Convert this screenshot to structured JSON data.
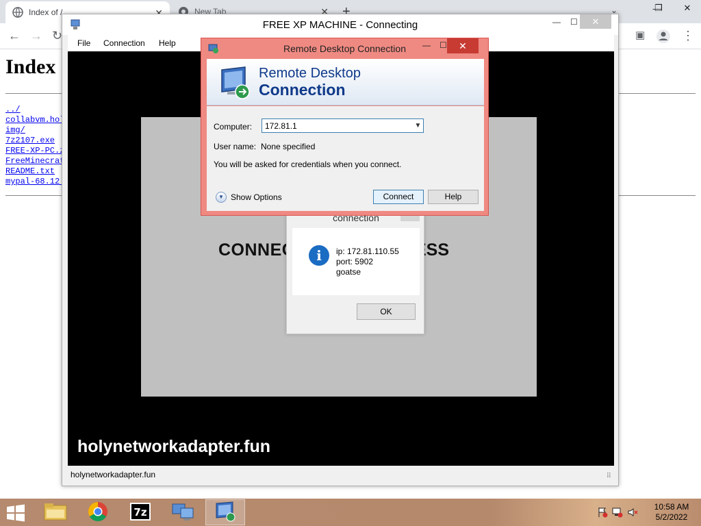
{
  "browser": {
    "tabs": [
      {
        "title": "Index of /",
        "active": true
      },
      {
        "title": "New Tab",
        "active": false
      }
    ],
    "new_tab_glyph": "+",
    "page": {
      "heading": "Index",
      "files": [
        "../",
        "collabvm.hol",
        "img/",
        "7z2107.exe",
        "FREE-XP-PC.z",
        "FreeMinecrat",
        "README.txt",
        "mypal-68.12."
      ]
    }
  },
  "vnc_window": {
    "title": "FREE XP MACHINE - Connecting",
    "menu": [
      "File",
      "Connection",
      "Help"
    ],
    "screen_text": "CONNEC",
    "screen_text_right": "ESS",
    "watermark": "holynetworkadapter.fun",
    "status": "holynetworkadapter.fun"
  },
  "conn_dialog": {
    "title": "connection",
    "lines": [
      "ip: 172.81.110.55",
      "port: 5902",
      "goatse"
    ],
    "ok_label": "OK"
  },
  "rdc_dialog": {
    "title": "Remote Desktop Connection",
    "banner_line1": "Remote Desktop",
    "banner_line2": "Connection",
    "computer_label": "Computer:",
    "computer_value": "172.81.1",
    "username_label": "User name:",
    "username_value": "None specified",
    "note": "You will be asked for credentials when you connect.",
    "show_options": "Show Options",
    "connect_label": "Connect",
    "help_label": "Help"
  },
  "taskbar": {
    "apps": [
      "file-explorer",
      "chrome",
      "7-zip",
      "network",
      "remote-desktop"
    ],
    "clock_time": "10:58 AM",
    "clock_date": "5/2/2022"
  }
}
